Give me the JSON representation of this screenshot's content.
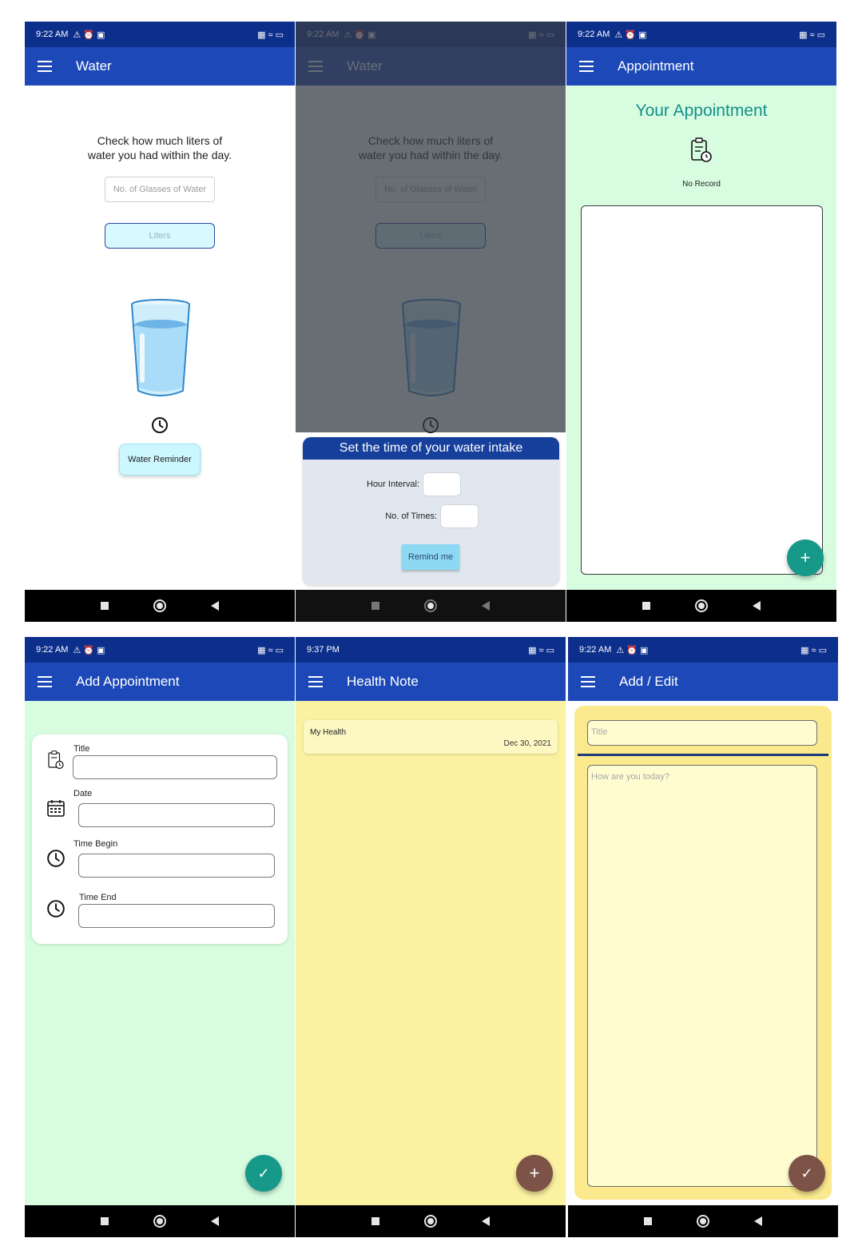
{
  "colors": {
    "status_bar": "#0d2f8c",
    "app_bar": "#1d49b8",
    "mint_background": "#d7fce0",
    "yellow_background": "#faf1a1",
    "teal_fab": "#17998a",
    "brown_fab": "#7d5247",
    "appointment_title": "#14908a"
  },
  "status": {
    "time_am": "9:22 AM",
    "time_pm": "9:37 PM"
  },
  "water": {
    "title": "Water",
    "prompt_line1": "Check how much liters of",
    "prompt_line2": "water you had within the day.",
    "glasses_placeholder": "No. of Glasses of Water",
    "liters_placeholder": "Liters",
    "reminder_button": "Water Reminder",
    "glass_icon": "water-glass-icon",
    "clock_icon": "clock-icon"
  },
  "reminder_dialog": {
    "heading": "Set the time of your water intake",
    "hour_interval_label": "Hour Interval:",
    "times_label": "No. of Times:",
    "remind_button": "Remind me"
  },
  "appointment": {
    "title": "Appointment",
    "heading": "Your Appointment",
    "empty_text": "No Record",
    "record_icon": "record-clock-icon",
    "add_icon": "plus-icon"
  },
  "add_appointment": {
    "title": "Add Appointment",
    "fields": [
      {
        "label": "Title",
        "icon": "record-clock-icon"
      },
      {
        "label": "Date",
        "icon": "calendar-icon"
      },
      {
        "label": "Time Begin",
        "icon": "clock-icon"
      },
      {
        "label": "Time End",
        "icon": "clock-icon"
      }
    ],
    "save_icon": "check-icon"
  },
  "health_note": {
    "title": "Health Note",
    "notes": [
      {
        "title": "My Health",
        "date": "Dec 30, 2021"
      }
    ],
    "add_icon": "plus-icon"
  },
  "add_edit": {
    "title": "Add / Edit",
    "title_placeholder": "Title",
    "body_placeholder": "How are you today?",
    "save_icon": "check-icon"
  }
}
